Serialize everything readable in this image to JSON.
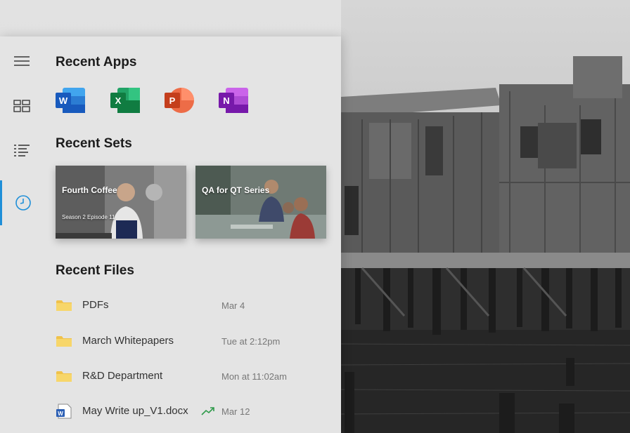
{
  "rail": {
    "items": [
      {
        "name": "menu",
        "icon": "hamburger-icon"
      },
      {
        "name": "sets",
        "icon": "sets-grid-icon"
      },
      {
        "name": "list",
        "icon": "list-icon"
      },
      {
        "name": "recent",
        "icon": "clock-icon",
        "active": true
      }
    ],
    "accent_color": "#1f8fd8"
  },
  "recent_apps": {
    "title": "Recent Apps",
    "apps": [
      {
        "name": "Word",
        "letter": "W",
        "icon": "word-icon",
        "color": "#2b5fb4"
      },
      {
        "name": "Excel",
        "letter": "X",
        "icon": "excel-icon",
        "color": "#1e7145"
      },
      {
        "name": "PowerPoint",
        "letter": "P",
        "icon": "powerpoint-icon",
        "color": "#d24726"
      },
      {
        "name": "OneNote",
        "letter": "N",
        "icon": "onenote-icon",
        "color": "#7a3b9e"
      }
    ]
  },
  "recent_sets": {
    "title": "Recent Sets",
    "sets": [
      {
        "title": "Fourth Coffee",
        "subtitle": "Season 2 Episode 11"
      },
      {
        "title": "QA for QT Series",
        "subtitle": ""
      }
    ]
  },
  "recent_files": {
    "title": "Recent Files",
    "files": [
      {
        "name": "PDFs",
        "date": "Mar 4",
        "icon": "folder-icon"
      },
      {
        "name": "March Whitepapers",
        "date": "Tue at 2:12pm",
        "icon": "folder-icon"
      },
      {
        "name": "R&D Department",
        "date": "Mon at 11:02am",
        "icon": "folder-icon"
      },
      {
        "name": "May Write up_V1.docx",
        "date": "Mar 12",
        "icon": "word-doc-icon",
        "trending": true
      }
    ]
  }
}
